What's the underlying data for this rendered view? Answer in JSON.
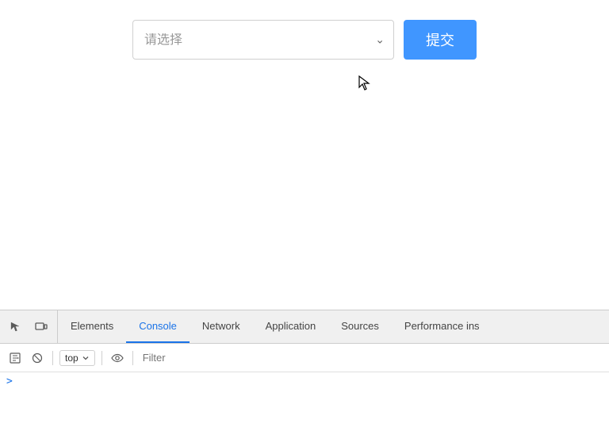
{
  "page": {
    "background": "#ffffff"
  },
  "form": {
    "select_placeholder": "请选择",
    "submit_label": "提交"
  },
  "devtools": {
    "icons": {
      "inspect": "⬚",
      "device": "▭"
    },
    "tabs": [
      {
        "id": "elements",
        "label": "Elements",
        "active": false
      },
      {
        "id": "console",
        "label": "Console",
        "active": true
      },
      {
        "id": "network",
        "label": "Network",
        "active": false
      },
      {
        "id": "application",
        "label": "Application",
        "active": false
      },
      {
        "id": "sources",
        "label": "Sources",
        "active": false
      },
      {
        "id": "performance",
        "label": "Performance ins",
        "active": false
      }
    ],
    "toolbar": {
      "top_label": "top",
      "filter_placeholder": "Filter"
    },
    "console_prompt": ">"
  }
}
